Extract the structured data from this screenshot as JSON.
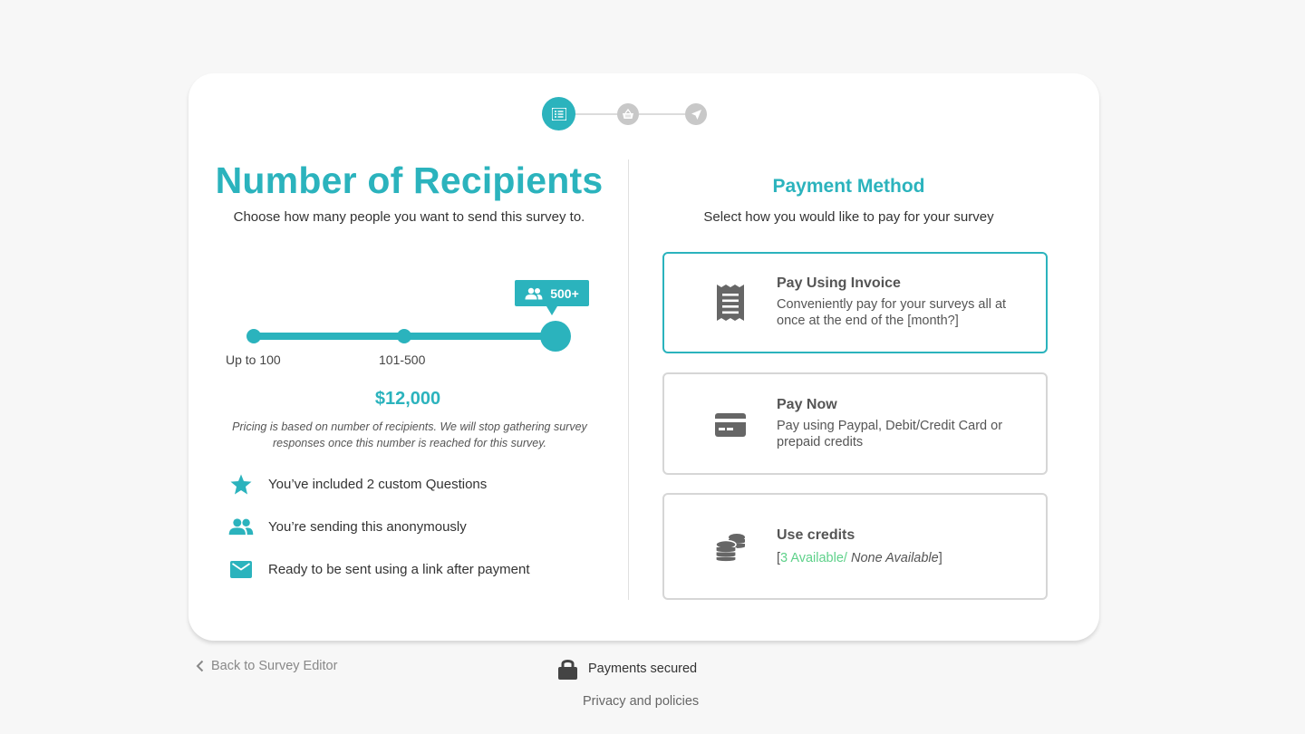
{
  "stepper": {
    "steps": [
      {
        "icon": "list-icon",
        "active": true
      },
      {
        "icon": "basket-icon",
        "active": false
      },
      {
        "icon": "send-icon",
        "active": false
      }
    ]
  },
  "recipients": {
    "title": "Number of Recipients",
    "subtitle": "Choose how many people you want to send this survey to.",
    "slider": {
      "options": [
        "Up to 100",
        "101-500",
        "500+"
      ],
      "selected_label": "500+",
      "selected_index": 2
    },
    "price": "$12,000",
    "note": "Pricing is based on number of recipients. We will stop gathering survey responses once this number is reached for this survey.",
    "features": [
      {
        "icon": "star-icon",
        "text": "You’ve included 2 custom Questions"
      },
      {
        "icon": "people-icon",
        "text": "You’re sending this anonymously"
      },
      {
        "icon": "envelope-icon",
        "text": "Ready to be sent using a link after payment"
      }
    ]
  },
  "payment": {
    "title": "Payment Method",
    "subtitle": "Select how you would like to pay for your survey",
    "options": [
      {
        "icon": "receipt-icon",
        "title": "Pay Using Invoice",
        "description": "Conveniently pay for your surveys all at once at the end of the [month?]",
        "selected": true
      },
      {
        "icon": "credit-card-icon",
        "title": "Pay Now",
        "description": "Pay using Paypal, Debit/Credit Card or prepaid credits",
        "selected": false
      },
      {
        "icon": "coins-icon",
        "title": "Use credits",
        "available_text": "3 Available/",
        "none_text": "None Available",
        "selected": false
      }
    ]
  },
  "footer": {
    "back_label": "Back to Survey Editor",
    "secured_label": "Payments secured",
    "privacy_label": "Privacy and policies"
  },
  "colors": {
    "accent": "#2bb3bd",
    "inactive_step": "#c8c8c8",
    "available": "#5ed18a",
    "icon_gray": "#666666"
  }
}
